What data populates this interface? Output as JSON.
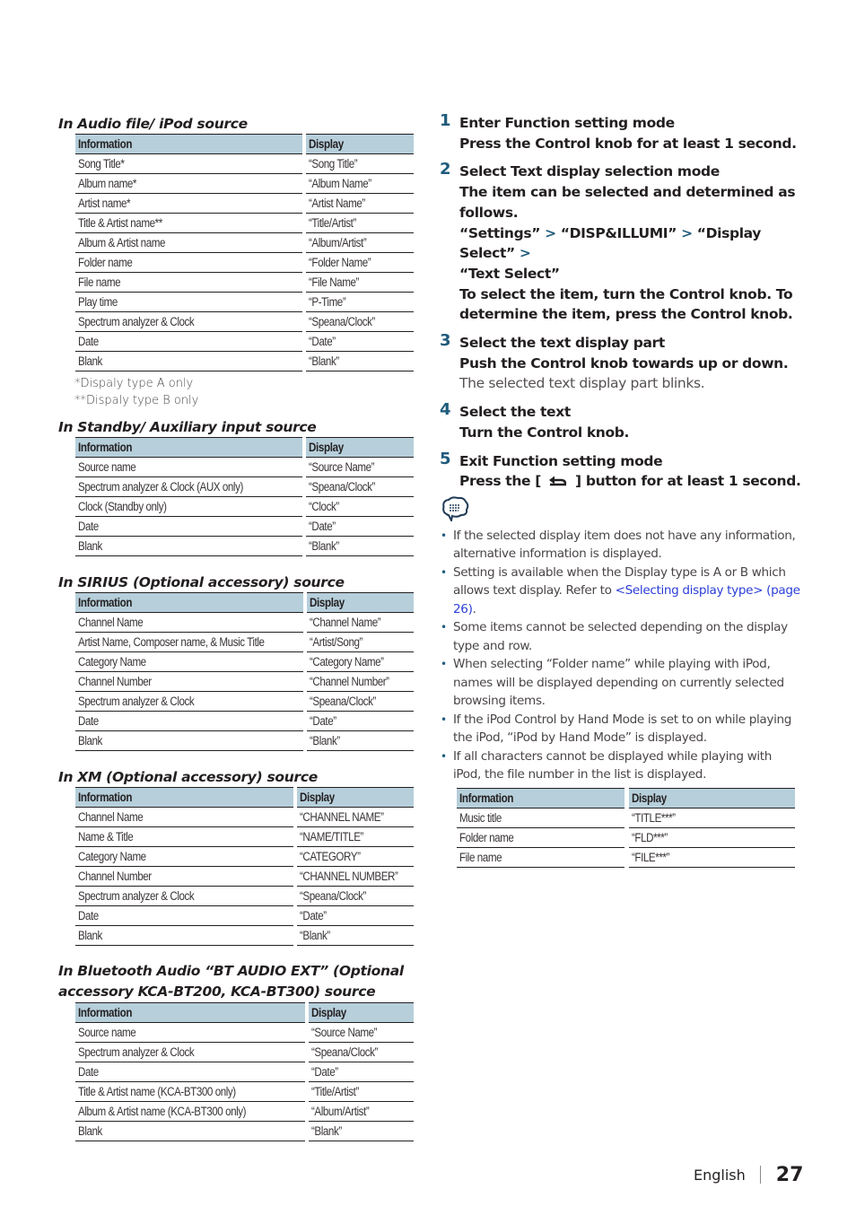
{
  "left": {
    "sections": [
      {
        "title": "In Audio file/ iPod source",
        "headers": [
          "Information",
          "Display"
        ],
        "rows": [
          [
            "Song Title*",
            "“Song Title”"
          ],
          [
            "Album name*",
            "“Album Name”"
          ],
          [
            "Artist name*",
            "“Artist Name”"
          ],
          [
            "Title & Artist name**",
            "“Title/Artist”"
          ],
          [
            "Album & Artist name",
            "“Album/Artist”"
          ],
          [
            "Folder name",
            "“Folder Name”"
          ],
          [
            "File name",
            "“File Name”"
          ],
          [
            "Play time",
            "“P-Time”"
          ],
          [
            "Spectrum analyzer & Clock",
            "“Speana/Clock”"
          ],
          [
            "Date",
            "“Date”"
          ],
          [
            "Blank",
            "“Blank”"
          ]
        ],
        "footnotes": [
          "*Dispaly type A only",
          "**Dispaly type B only"
        ]
      },
      {
        "title": "In Standby/ Auxiliary input source",
        "headers": [
          "Information",
          "Display"
        ],
        "rows": [
          [
            "Source name",
            "“Source Name”"
          ],
          [
            "Spectrum analyzer & Clock (AUX only)",
            "“Speana/Clock”"
          ],
          [
            "Clock (Standby only)",
            "“Clock”"
          ],
          [
            "Date",
            "“Date”"
          ],
          [
            "Blank",
            "“Blank”"
          ]
        ]
      },
      {
        "title": "In SIRIUS (Optional accessory) source",
        "headers": [
          "Information",
          "Display"
        ],
        "rows": [
          [
            "Channel Name",
            "“Channel Name”"
          ],
          [
            "Artist Name, Composer name, & Music Title",
            "“Artist/Song”"
          ],
          [
            "Category Name",
            "“Category Name”"
          ],
          [
            "Channel Number",
            "“Channel Number”"
          ],
          [
            "Spectrum analyzer & Clock",
            "“Speana/Clock”"
          ],
          [
            "Date",
            "“Date”"
          ],
          [
            "Blank",
            "“Blank”"
          ]
        ]
      },
      {
        "title": "In XM (Optional accessory) source",
        "headers": [
          "Information",
          "Display"
        ],
        "rows": [
          [
            "Channel Name",
            "“CHANNEL NAME”"
          ],
          [
            "Name & Title",
            "“NAME/TITLE”"
          ],
          [
            "Category Name",
            "“CATEGORY”"
          ],
          [
            "Channel Number",
            "“CHANNEL NUMBER”"
          ],
          [
            "Spectrum analyzer & Clock",
            "“Speana/Clock”"
          ],
          [
            "Date",
            "“Date”"
          ],
          [
            "Blank",
            "“Blank”"
          ]
        ]
      },
      {
        "title": "In Bluetooth Audio “BT AUDIO EXT” (Optional accessory KCA-BT200, KCA-BT300) source",
        "headers": [
          "Information",
          "Display"
        ],
        "rows": [
          [
            "Source name",
            "“Source Name”"
          ],
          [
            "Spectrum analyzer & Clock",
            "“Speana/Clock”"
          ],
          [
            "Date",
            "“Date”"
          ],
          [
            "Title & Artist name (KCA-BT300 only)",
            "“Title/Artist”"
          ],
          [
            "Album & Artist name (KCA-BT300 only)",
            "“Album/Artist”"
          ],
          [
            "Blank",
            "“Blank”"
          ]
        ]
      }
    ]
  },
  "right": {
    "steps": [
      {
        "num": "1",
        "title": "Enter Function setting mode",
        "body": "Press the Control knob for at least 1 second."
      },
      {
        "num": "2",
        "title": "Select Text display selection mode",
        "body": "The item can be selected and determined as follows.",
        "path": [
          "“Settings”",
          "“DISP&ILLUMI”",
          "“Display Select”",
          "“Text Select”"
        ],
        "body2": "To select the item, turn the Control knob. To determine the item, press the Control knob."
      },
      {
        "num": "3",
        "title": "Select the text display part",
        "body": "Push the Control knob towards up or down.",
        "note": "The selected text display part blinks."
      },
      {
        "num": "4",
        "title": "Select the text",
        "body": "Turn the Control knob."
      },
      {
        "num": "5",
        "title": "Exit Function setting mode",
        "body_pre": "Press the [",
        "body_post": "] button for at least 1 second."
      }
    ],
    "path_separator": ">",
    "notes_icon": "note-speech-bubble-icon",
    "return_icon": "return-arrow-icon",
    "notes": [
      {
        "text": "If the selected display item does not have any information, alternative information is displayed."
      },
      {
        "text": "Setting is available when the Display type is A or B which allows text display. Refer to ",
        "link": "<Selecting display type> (page 26)",
        "after": "."
      },
      {
        "text": "Some items cannot be selected depending on the display type and row."
      },
      {
        "text": "When selecting “Folder name” while playing with iPod, names will be displayed depending on currently selected browsing items."
      },
      {
        "text": "If the iPod Control by Hand Mode is set to on while playing the iPod, “iPod by Hand Mode” is displayed."
      },
      {
        "text": "If all characters cannot be displayed while playing with iPod, the file number in the list is displayed."
      }
    ],
    "ipod_table": {
      "headers": [
        "Information",
        "Display"
      ],
      "rows": [
        [
          "Music title",
          "“TITLE***”"
        ],
        [
          "Folder name",
          "“FLD***”"
        ],
        [
          "File name",
          "“FILE***”"
        ]
      ]
    }
  },
  "footer": {
    "language": "English",
    "page": "27"
  },
  "colors": {
    "table_header": "#b6cfdb",
    "step_number": "#1f5b7c",
    "link": "#2b3ed6"
  }
}
